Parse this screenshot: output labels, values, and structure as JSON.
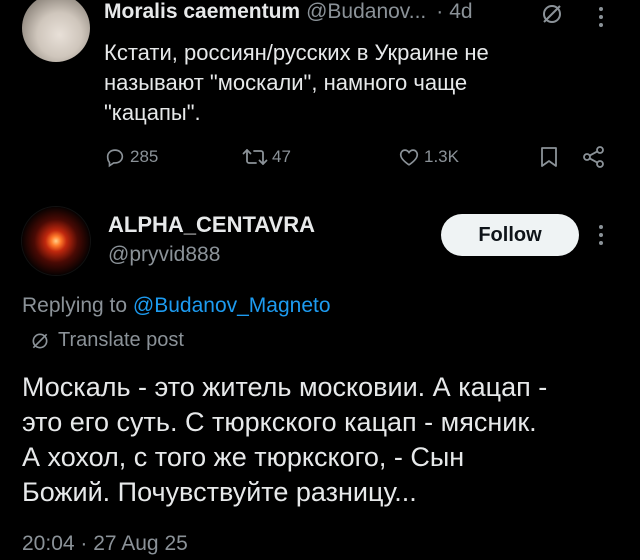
{
  "tweet1": {
    "display_name": "Moralis caementum",
    "handle": "@Budanov...",
    "separator": "·",
    "time": "4d",
    "text_lines": [
      "Кстати, россиян/русских в Украине не",
      "называют \"москали\", намного чаще",
      "\"кацапы\"."
    ],
    "actions": {
      "replies": "285",
      "reposts": "47",
      "likes": "1.3K"
    }
  },
  "tweet2": {
    "display_name": "ALPHA_CENTAVRA",
    "handle": "@pryvid888",
    "follow_label": "Follow",
    "replying_prefix": "Replying to ",
    "replying_handle": "@Budanov_Magneto",
    "translate_label": "Translate post",
    "text_lines": [
      "Москаль - это житель московии. А кацап -",
      "это его суть. С тюркского кацап - мясник.",
      "А хохол, с того же тюркского, - Сын",
      "Божий. Почувствуйте разницу..."
    ],
    "timestamp": "20:04 · 27 Aug 25"
  },
  "icons": {
    "reply": "reply-icon",
    "repost": "repost-icon",
    "like": "like-icon",
    "bookmark": "bookmark-icon",
    "share": "share-icon",
    "more": "more-icon",
    "grok": "grok-icon",
    "translate": "translate-icon"
  },
  "colors": {
    "background": "#000000",
    "text": "#e7e9ea",
    "muted": "#8b9298",
    "link": "#1d9bf0",
    "follow_bg": "#eff3f4"
  }
}
